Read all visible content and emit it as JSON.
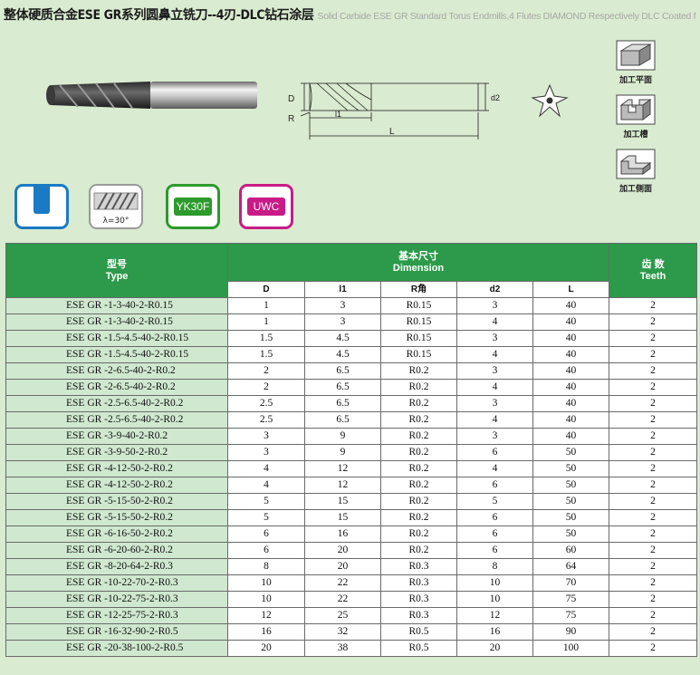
{
  "header": {
    "title_cn": "整体硬质合金ESE GR系列圆鼻立铣刀--4刃-DLC钻石涂层",
    "title_en": "Solid Carbide ESE GR Standard Torus Endmills,4 Flutes DIAMOND Respectively DLC Coated for machining grahite"
  },
  "drawing": {
    "label_D": "D",
    "label_R": "R",
    "label_l1": "l1",
    "label_d2": "d2",
    "label_L": "L"
  },
  "operations": [
    {
      "label": "加工平面",
      "icon": "flat-surface-icon"
    },
    {
      "label": "加工槽",
      "icon": "slot-icon"
    },
    {
      "label": "加工侧面",
      "icon": "side-milling-icon"
    }
  ],
  "badges": {
    "helix": "λ=30°",
    "grade": "YK30F",
    "coating": "UWC",
    "colors": {
      "blue": "#1a7ac4",
      "green": "#2c9a2c",
      "magenta": "#c81b86"
    }
  },
  "table": {
    "type_header_cn": "型号",
    "type_header_en": "Type",
    "dim_header_cn": "基本尺寸",
    "dim_header_en": "Dimension",
    "teeth_header_cn": "齿 数",
    "teeth_header_en": "Teeth",
    "sub_headers": [
      "D",
      "l1",
      "R角",
      "d2",
      "L"
    ],
    "rows": [
      {
        "type": "ESE GR -1-3-40-2-R0.15",
        "D": "1",
        "l1": "3",
        "R": "R0.15",
        "d2": "3",
        "L": "40",
        "teeth": "2"
      },
      {
        "type": "ESE GR -1-3-40-2-R0.15",
        "D": "1",
        "l1": "3",
        "R": "R0.15",
        "d2": "4",
        "L": "40",
        "teeth": "2"
      },
      {
        "type": "ESE GR -1.5-4.5-40-2-R0.15",
        "D": "1.5",
        "l1": "4.5",
        "R": "R0.15",
        "d2": "3",
        "L": "40",
        "teeth": "2"
      },
      {
        "type": "ESE GR -1.5-4.5-40-2-R0.15",
        "D": "1.5",
        "l1": "4.5",
        "R": "R0.15",
        "d2": "4",
        "L": "40",
        "teeth": "2"
      },
      {
        "type": "ESE GR -2-6.5-40-2-R0.2",
        "D": "2",
        "l1": "6.5",
        "R": "R0.2",
        "d2": "3",
        "L": "40",
        "teeth": "2"
      },
      {
        "type": "ESE GR -2-6.5-40-2-R0.2",
        "D": "2",
        "l1": "6.5",
        "R": "R0.2",
        "d2": "4",
        "L": "40",
        "teeth": "2"
      },
      {
        "type": "ESE GR -2.5-6.5-40-2-R0.2",
        "D": "2.5",
        "l1": "6.5",
        "R": "R0.2",
        "d2": "3",
        "L": "40",
        "teeth": "2"
      },
      {
        "type": "ESE GR -2.5-6.5-40-2-R0.2",
        "D": "2.5",
        "l1": "6.5",
        "R": "R0.2",
        "d2": "4",
        "L": "40",
        "teeth": "2"
      },
      {
        "type": "ESE GR -3-9-40-2-R0.2",
        "D": "3",
        "l1": "9",
        "R": "R0.2",
        "d2": "3",
        "L": "40",
        "teeth": "2"
      },
      {
        "type": "ESE GR -3-9-50-2-R0.2",
        "D": "3",
        "l1": "9",
        "R": "R0.2",
        "d2": "6",
        "L": "50",
        "teeth": "2"
      },
      {
        "type": "ESE GR -4-12-50-2-R0.2",
        "D": "4",
        "l1": "12",
        "R": "R0.2",
        "d2": "4",
        "L": "50",
        "teeth": "2"
      },
      {
        "type": "ESE GR -4-12-50-2-R0.2",
        "D": "4",
        "l1": "12",
        "R": "R0.2",
        "d2": "6",
        "L": "50",
        "teeth": "2"
      },
      {
        "type": "ESE GR -5-15-50-2-R0.2",
        "D": "5",
        "l1": "15",
        "R": "R0.2",
        "d2": "5",
        "L": "50",
        "teeth": "2"
      },
      {
        "type": "ESE GR -5-15-50-2-R0.2",
        "D": "5",
        "l1": "15",
        "R": "R0.2",
        "d2": "6",
        "L": "50",
        "teeth": "2"
      },
      {
        "type": "ESE GR -6-16-50-2-R0.2",
        "D": "6",
        "l1": "16",
        "R": "R0.2",
        "d2": "6",
        "L": "50",
        "teeth": "2"
      },
      {
        "type": "ESE GR -6-20-60-2-R0.2",
        "D": "6",
        "l1": "20",
        "R": "R0.2",
        "d2": "6",
        "L": "60",
        "teeth": "2"
      },
      {
        "type": "ESE GR -8-20-64-2-R0.3",
        "D": "8",
        "l1": "20",
        "R": "R0.3",
        "d2": "8",
        "L": "64",
        "teeth": "2"
      },
      {
        "type": "ESE GR -10-22-70-2-R0.3",
        "D": "10",
        "l1": "22",
        "R": "R0.3",
        "d2": "10",
        "L": "70",
        "teeth": "2"
      },
      {
        "type": "ESE GR -10-22-75-2-R0.3",
        "D": "10",
        "l1": "22",
        "R": "R0.3",
        "d2": "10",
        "L": "75",
        "teeth": "2"
      },
      {
        "type": "ESE GR -12-25-75-2-R0.3",
        "D": "12",
        "l1": "25",
        "R": "R0.3",
        "d2": "12",
        "L": "75",
        "teeth": "2"
      },
      {
        "type": "ESE GR -16-32-90-2-R0.5",
        "D": "16",
        "l1": "32",
        "R": "R0.5",
        "d2": "16",
        "L": "90",
        "teeth": "2"
      },
      {
        "type": "ESE GR -20-38-100-2-R0.5",
        "D": "20",
        "l1": "38",
        "R": "R0.5",
        "d2": "20",
        "L": "100",
        "teeth": "2"
      }
    ]
  }
}
